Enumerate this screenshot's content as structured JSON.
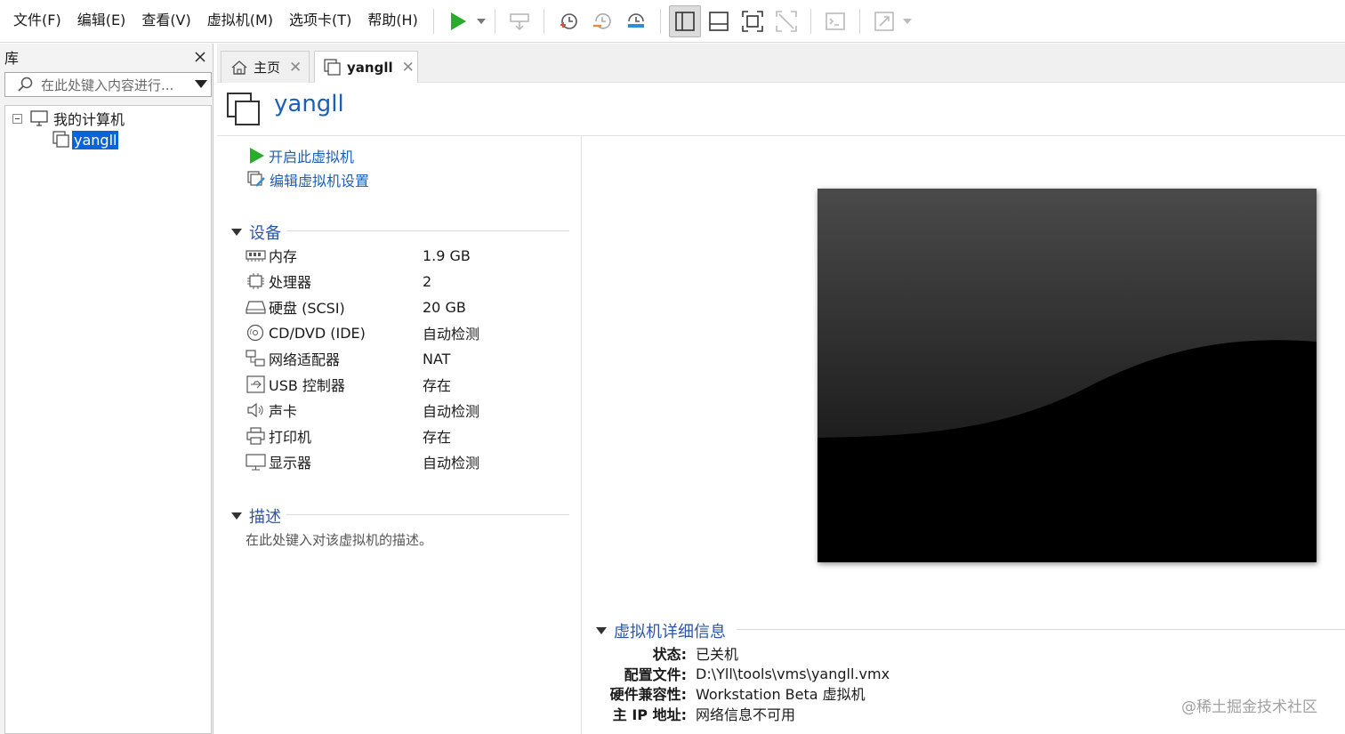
{
  "menu": [
    "文件(F)",
    "编辑(E)",
    "查看(V)",
    "虚拟机(M)",
    "选项卡(T)",
    "帮助(H)"
  ],
  "toolbar_icons": [
    "play-icon",
    "send-keys-icon",
    "snapshot-icon",
    "revert-snapshot-icon",
    "snapshot-manager-icon",
    "library-view-icon",
    "thumbnail-bar-icon",
    "fullscreen-icon",
    "unity-icon",
    "console-icon",
    "stretch-icon"
  ],
  "library": {
    "title": "库",
    "search_placeholder": "在此处键入内容进行...",
    "tree": {
      "root": "我的计算机",
      "vm": "yangll"
    }
  },
  "tabs": [
    {
      "label": "主页",
      "active": false
    },
    {
      "label": "yangll",
      "active": true
    }
  ],
  "vm": {
    "name": "yangll",
    "actions": {
      "power_on": "开启此虚拟机",
      "edit_settings": "编辑虚拟机设置"
    },
    "devices_title": "设备",
    "devices": [
      {
        "icon": "memory-icon",
        "name": "内存",
        "value": "1.9 GB"
      },
      {
        "icon": "cpu-icon",
        "name": "处理器",
        "value": "2"
      },
      {
        "icon": "hard-disk-icon",
        "name": "硬盘 (SCSI)",
        "value": "20 GB"
      },
      {
        "icon": "cd-dvd-icon",
        "name": "CD/DVD (IDE)",
        "value": "自动检测"
      },
      {
        "icon": "network-adapter-icon",
        "name": "网络适配器",
        "value": "NAT"
      },
      {
        "icon": "usb-icon",
        "name": "USB 控制器",
        "value": "存在"
      },
      {
        "icon": "sound-card-icon",
        "name": "声卡",
        "value": "自动检测"
      },
      {
        "icon": "printer-icon",
        "name": "打印机",
        "value": "存在"
      },
      {
        "icon": "display-icon",
        "name": "显示器",
        "value": "自动检测"
      }
    ],
    "description_title": "描述",
    "description_placeholder": "在此处键入对该虚拟机的描述。",
    "details_title": "虚拟机详细信息",
    "details": [
      {
        "label": "状态:",
        "value": "已关机"
      },
      {
        "label": "配置文件:",
        "value": "D:\\Yll\\tools\\vms\\yangll.vmx"
      },
      {
        "label": "硬件兼容性:",
        "value": "Workstation Beta 虚拟机"
      },
      {
        "label": "主 IP 地址:",
        "value": "网络信息不可用"
      }
    ]
  },
  "watermark": "@稀土掘金技术社区",
  "colors": {
    "accent": "#1c5fb8",
    "play_green": "#2bab2b",
    "selection": "#0a64d6"
  }
}
